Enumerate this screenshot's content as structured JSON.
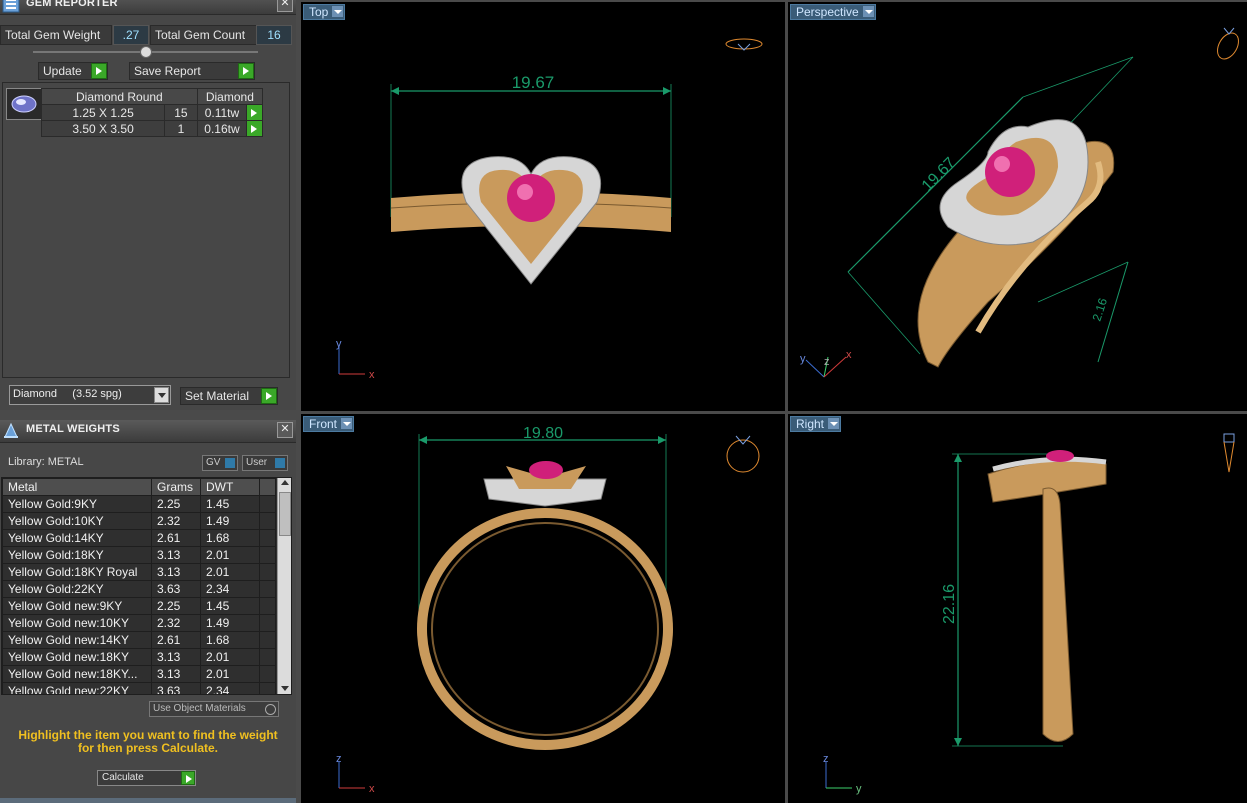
{
  "gem_reporter": {
    "title": "GEM REPORTER",
    "total_gem_weight_label": "Total Gem Weight",
    "total_gem_weight_value": ".27",
    "total_gem_count_label": "Total Gem Count",
    "total_gem_count_value": "16",
    "update_label": "Update",
    "save_report_label": "Save Report",
    "table_header_shape": "Diamond Round",
    "table_header_material": "Diamond",
    "rows": [
      {
        "size": "1.25 X 1.25",
        "count": "15",
        "weight": "0.11tw"
      },
      {
        "size": "3.50 X 3.50",
        "count": "1",
        "weight": "0.16tw"
      }
    ],
    "material_select": "Diamond     (3.52 spg)",
    "set_material_label": "Set Material"
  },
  "metal_weights": {
    "title": "METAL WEIGHTS",
    "library_label": "Library: METAL",
    "gv_label": "GV",
    "user_label": "User",
    "columns": [
      "Metal",
      "Grams",
      "DWT"
    ],
    "rows": [
      {
        "metal": "Yellow Gold:9KY",
        "grams": "2.25",
        "dwt": "1.45"
      },
      {
        "metal": "Yellow Gold:10KY",
        "grams": "2.32",
        "dwt": "1.49"
      },
      {
        "metal": "Yellow Gold:14KY",
        "grams": "2.61",
        "dwt": "1.68"
      },
      {
        "metal": "Yellow Gold:18KY",
        "grams": "3.13",
        "dwt": "2.01"
      },
      {
        "metal": "Yellow Gold:18KY Royal",
        "grams": "3.13",
        "dwt": "2.01"
      },
      {
        "metal": "Yellow Gold:22KY",
        "grams": "3.63",
        "dwt": "2.34"
      },
      {
        "metal": "Yellow Gold new:9KY",
        "grams": "2.25",
        "dwt": "1.45"
      },
      {
        "metal": "Yellow Gold new:10KY",
        "grams": "2.32",
        "dwt": "1.49"
      },
      {
        "metal": "Yellow Gold new:14KY",
        "grams": "2.61",
        "dwt": "1.68"
      },
      {
        "metal": "Yellow Gold new:18KY",
        "grams": "3.13",
        "dwt": "2.01"
      },
      {
        "metal": "Yellow Gold new:18KY...",
        "grams": "3.13",
        "dwt": "2.01"
      },
      {
        "metal": "Yellow Gold new:22KY",
        "grams": "3.63",
        "dwt": "2.34"
      }
    ],
    "use_object_materials_label": "Use Object Materials",
    "hint": "Highlight the item you want to find the weight for then press Calculate.",
    "calculate_label": "Calculate"
  },
  "viewports": {
    "top": {
      "label": "Top",
      "dimension": "19.67",
      "axis_v": "y",
      "axis_h": "x"
    },
    "perspective": {
      "label": "Perspective",
      "dimension_a": "19.67",
      "dimension_b": "2.16",
      "axis_a": "y",
      "axis_b": "z",
      "axis_c": "x"
    },
    "front": {
      "label": "Front",
      "dimension": "19.80",
      "axis_v": "z",
      "axis_h": "x"
    },
    "right": {
      "label": "Right",
      "dimension": "22.16",
      "axis_v": "z",
      "axis_h": "y"
    }
  },
  "colors": {
    "gold": "#c99a5c",
    "ruby": "#d0207a",
    "dimension_line": "#1a9a6a",
    "accent_go": "#3aa828"
  }
}
